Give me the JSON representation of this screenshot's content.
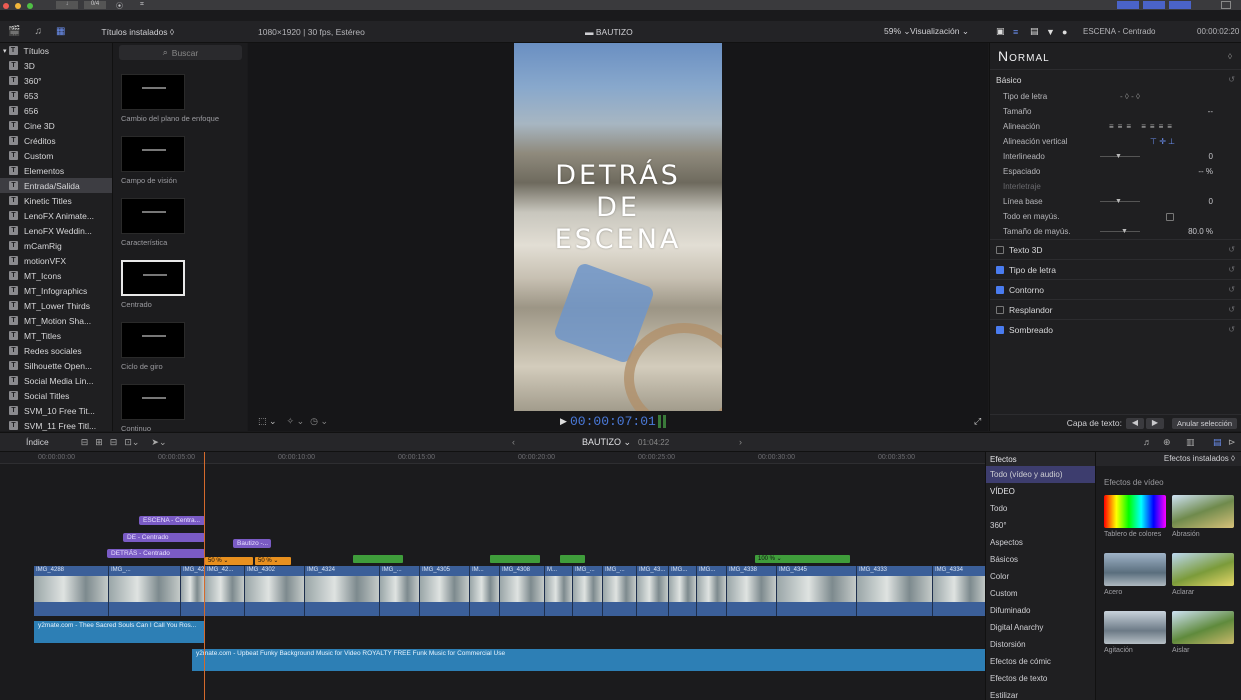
{
  "toolbar": {
    "btn1": "↓",
    "btn2": "0/4",
    "btn3": "⦿",
    "btn4": "⌗"
  },
  "library": {
    "header_title": "Títulos instalados",
    "search_placeholder": "Buscar",
    "format": "1080×1920 | 30 fps, Estéreo",
    "project": "BAUTIZO",
    "zoom": "59%",
    "view_menu": "Visualización"
  },
  "sidebar": {
    "root": "Títulos",
    "items": [
      "3D",
      "360°",
      "653",
      "656",
      "Cine 3D",
      "Créditos",
      "Custom",
      "Elementos",
      "Entrada/Salida",
      "Kinetic Titles",
      "LenoFX Animate...",
      "LenoFX Weddin...",
      "mCamRig",
      "motionVFX",
      "MT_Icons",
      "MT_Infographics",
      "MT_Lower Thirds",
      "MT_Motion Sha...",
      "MT_Titles",
      "Redes sociales",
      "Silhouette Open...",
      "Social Media Lin...",
      "Social Titles",
      "SVM_10 Free Tit...",
      "SVM_11 Free Titl..."
    ],
    "selected_index": 8
  },
  "browser": {
    "items": [
      "Cambio del plano de enfoque",
      "Campo de visión",
      "Característica",
      "Centrado",
      "Ciclo de giro",
      "Continuo"
    ],
    "selected_index": 3
  },
  "viewer": {
    "title_lines": [
      "DETRÁS",
      "DE",
      "ESCENA"
    ],
    "timecode": "00:00:07:01"
  },
  "inspector": {
    "clip_name": "ESCENA - Centrado",
    "duration": "00:00:02:20",
    "style": "Normal",
    "basic_section": "Básico",
    "rows": [
      {
        "label": "Tipo de letra",
        "value": "",
        "dim": false
      },
      {
        "label": "Tamaño",
        "value": "--",
        "dim": false
      },
      {
        "label": "Alineación",
        "value": "",
        "dim": false
      },
      {
        "label": "Alineación vertical",
        "value": "",
        "dim": false
      },
      {
        "label": "Interlineado",
        "value": "0",
        "dim": false
      },
      {
        "label": "Espaciado",
        "value": "-- %",
        "dim": false
      },
      {
        "label": "Interletraje",
        "value": "",
        "dim": true
      },
      {
        "label": "Línea base",
        "value": "0",
        "dim": false
      },
      {
        "label": "Todo en mayús.",
        "value": "",
        "dim": false
      },
      {
        "label": "Tamaño de mayús.",
        "value": "80.0 %",
        "dim": false
      }
    ],
    "sections": [
      {
        "label": "Texto 3D",
        "checked": false
      },
      {
        "label": "Tipo de letra",
        "checked": true
      },
      {
        "label": "Contorno",
        "checked": true
      },
      {
        "label": "Resplandor",
        "checked": false
      },
      {
        "label": "Sombreado",
        "checked": true
      }
    ],
    "text_layer_label": "Capa de texto:",
    "deselect_label": "Anular selección"
  },
  "timeline": {
    "index_label": "Índice",
    "project": "BAUTIZO",
    "duration": "01:04:22",
    "ruler": [
      "00:00:00:00",
      "00:00:05:00",
      "00:00:10:00",
      "00:00:15:00",
      "00:00:20:00",
      "00:00:25:00",
      "00:00:30:00",
      "00:00:35:00"
    ],
    "titles": [
      "ESCENA - Centra...",
      "DE - Centrado",
      "DETRÁS - Centrado",
      "Bautizo -..."
    ],
    "speed_labels": [
      "50 %",
      "50 %",
      "100 %"
    ],
    "clips": [
      "IMG_4288",
      "IMG_...",
      "IMG_4288",
      "IMG_42...",
      "IMG_4302",
      "IMG_4324",
      "IMG_...",
      "IMG_4305",
      "IM...",
      "IMG_4308",
      "M...",
      "IMG_...",
      "IMG_...",
      "IMG_43...",
      "IMG...",
      "IMG...",
      "IMG_4338",
      "IMG_4345",
      "IMG_4333",
      "IMG_4334"
    ],
    "audio1": "y2mate.com - Thee Sacred Souls Can I Call You Ros...",
    "audio2": "y2mate.com - Upbeat Funky Background Music for Video ROYALTY FREE Funk Music for Commercial Use"
  },
  "effects": {
    "header": "Efectos",
    "installed": "Efectos instalados",
    "categories": [
      "Todo (vídeo y audio)",
      "VÍDEO",
      "Todo",
      "360°",
      "Aspectos",
      "Básicos",
      "Color",
      "Custom",
      "Difuminado",
      "Digital Anarchy",
      "Distorsión",
      "Efectos de cómic",
      "Efectos de texto",
      "Estilizar"
    ],
    "video_effects_title": "Efectos de vídeo",
    "items": [
      "Tablero de colores",
      "Abrasión",
      "Acero",
      "Aclarar",
      "Agitación",
      "Aislar"
    ]
  }
}
